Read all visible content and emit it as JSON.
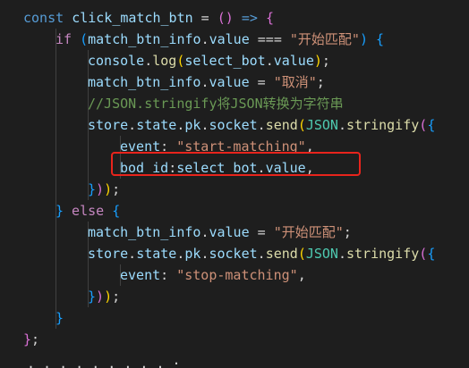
{
  "editor": {
    "background": "#1e1e1e",
    "highlight_color": "#e8241c",
    "lines": [
      [
        {
          "t": "const ",
          "c": "kw"
        },
        {
          "t": "click_match_btn",
          "c": "var"
        },
        {
          "t": " = ",
          "c": "punc"
        },
        {
          "t": "()",
          "c": "b2"
        },
        {
          "t": " => ",
          "c": "kw"
        },
        {
          "t": "{",
          "c": "b2"
        }
      ],
      [
        {
          "t": "if ",
          "c": "ctrl"
        },
        {
          "t": "(",
          "c": "b3"
        },
        {
          "t": "match_btn_info",
          "c": "var"
        },
        {
          "t": ".",
          "c": "punc"
        },
        {
          "t": "value",
          "c": "var"
        },
        {
          "t": " === ",
          "c": "punc"
        },
        {
          "t": "\"开始匹配\"",
          "c": "str"
        },
        {
          "t": ")",
          "c": "b3"
        },
        {
          "t": " ",
          "c": "punc"
        },
        {
          "t": "{",
          "c": "b3"
        }
      ],
      [
        {
          "t": "console",
          "c": "var"
        },
        {
          "t": ".",
          "c": "punc"
        },
        {
          "t": "log",
          "c": "fn"
        },
        {
          "t": "(",
          "c": "b1"
        },
        {
          "t": "select_bot",
          "c": "var"
        },
        {
          "t": ".",
          "c": "punc"
        },
        {
          "t": "value",
          "c": "var"
        },
        {
          "t": ")",
          "c": "b1"
        },
        {
          "t": ";",
          "c": "punc"
        }
      ],
      [
        {
          "t": "match_btn_info",
          "c": "var"
        },
        {
          "t": ".",
          "c": "punc"
        },
        {
          "t": "value",
          "c": "var"
        },
        {
          "t": " = ",
          "c": "punc"
        },
        {
          "t": "\"取消\"",
          "c": "str"
        },
        {
          "t": ";",
          "c": "punc"
        }
      ],
      [
        {
          "t": "//JSON.stringify将JSON转换为字符串",
          "c": "cmt"
        }
      ],
      [
        {
          "t": "store",
          "c": "var"
        },
        {
          "t": ".",
          "c": "punc"
        },
        {
          "t": "state",
          "c": "var"
        },
        {
          "t": ".",
          "c": "punc"
        },
        {
          "t": "pk",
          "c": "var"
        },
        {
          "t": ".",
          "c": "punc"
        },
        {
          "t": "socket",
          "c": "var"
        },
        {
          "t": ".",
          "c": "punc"
        },
        {
          "t": "send",
          "c": "fn"
        },
        {
          "t": "(",
          "c": "b1"
        },
        {
          "t": "JSON",
          "c": "cls"
        },
        {
          "t": ".",
          "c": "punc"
        },
        {
          "t": "stringify",
          "c": "fn"
        },
        {
          "t": "(",
          "c": "b2"
        },
        {
          "t": "{",
          "c": "b3"
        }
      ],
      [
        {
          "t": "event",
          "c": "var"
        },
        {
          "t": ": ",
          "c": "punc"
        },
        {
          "t": "\"start-matching\"",
          "c": "str"
        },
        {
          "t": ",",
          "c": "punc"
        }
      ],
      [
        {
          "t": "bod_id",
          "c": "var"
        },
        {
          "t": ":",
          "c": "punc"
        },
        {
          "t": "select_bot",
          "c": "var"
        },
        {
          "t": ".",
          "c": "punc"
        },
        {
          "t": "value",
          "c": "var"
        },
        {
          "t": ",",
          "c": "punc"
        }
      ],
      [
        {
          "t": "}",
          "c": "b3"
        },
        {
          "t": ")",
          "c": "b2"
        },
        {
          "t": ")",
          "c": "b1"
        },
        {
          "t": ";",
          "c": "punc"
        }
      ],
      [
        {
          "t": "}",
          "c": "b3"
        },
        {
          "t": " else ",
          "c": "ctrl"
        },
        {
          "t": "{",
          "c": "b3"
        }
      ],
      [
        {
          "t": "match_btn_info",
          "c": "var"
        },
        {
          "t": ".",
          "c": "punc"
        },
        {
          "t": "value",
          "c": "var"
        },
        {
          "t": " = ",
          "c": "punc"
        },
        {
          "t": "\"开始匹配\"",
          "c": "str"
        },
        {
          "t": ";",
          "c": "punc"
        }
      ],
      [
        {
          "t": "store",
          "c": "var"
        },
        {
          "t": ".",
          "c": "punc"
        },
        {
          "t": "state",
          "c": "var"
        },
        {
          "t": ".",
          "c": "punc"
        },
        {
          "t": "pk",
          "c": "var"
        },
        {
          "t": ".",
          "c": "punc"
        },
        {
          "t": "socket",
          "c": "var"
        },
        {
          "t": ".",
          "c": "punc"
        },
        {
          "t": "send",
          "c": "fn"
        },
        {
          "t": "(",
          "c": "b1"
        },
        {
          "t": "JSON",
          "c": "cls"
        },
        {
          "t": ".",
          "c": "punc"
        },
        {
          "t": "stringify",
          "c": "fn"
        },
        {
          "t": "(",
          "c": "b2"
        },
        {
          "t": "{",
          "c": "b3"
        }
      ],
      [
        {
          "t": "event",
          "c": "var"
        },
        {
          "t": ": ",
          "c": "punc"
        },
        {
          "t": "\"stop-matching\"",
          "c": "str"
        },
        {
          "t": ",",
          "c": "punc"
        }
      ],
      [
        {
          "t": "}",
          "c": "b3"
        },
        {
          "t": ")",
          "c": "b2"
        },
        {
          "t": ")",
          "c": "b1"
        },
        {
          "t": ";",
          "c": "punc"
        }
      ],
      [
        {
          "t": "}",
          "c": "b3"
        }
      ],
      [
        {
          "t": "}",
          "c": "b2"
        },
        {
          "t": ";",
          "c": "punc"
        }
      ]
    ]
  }
}
